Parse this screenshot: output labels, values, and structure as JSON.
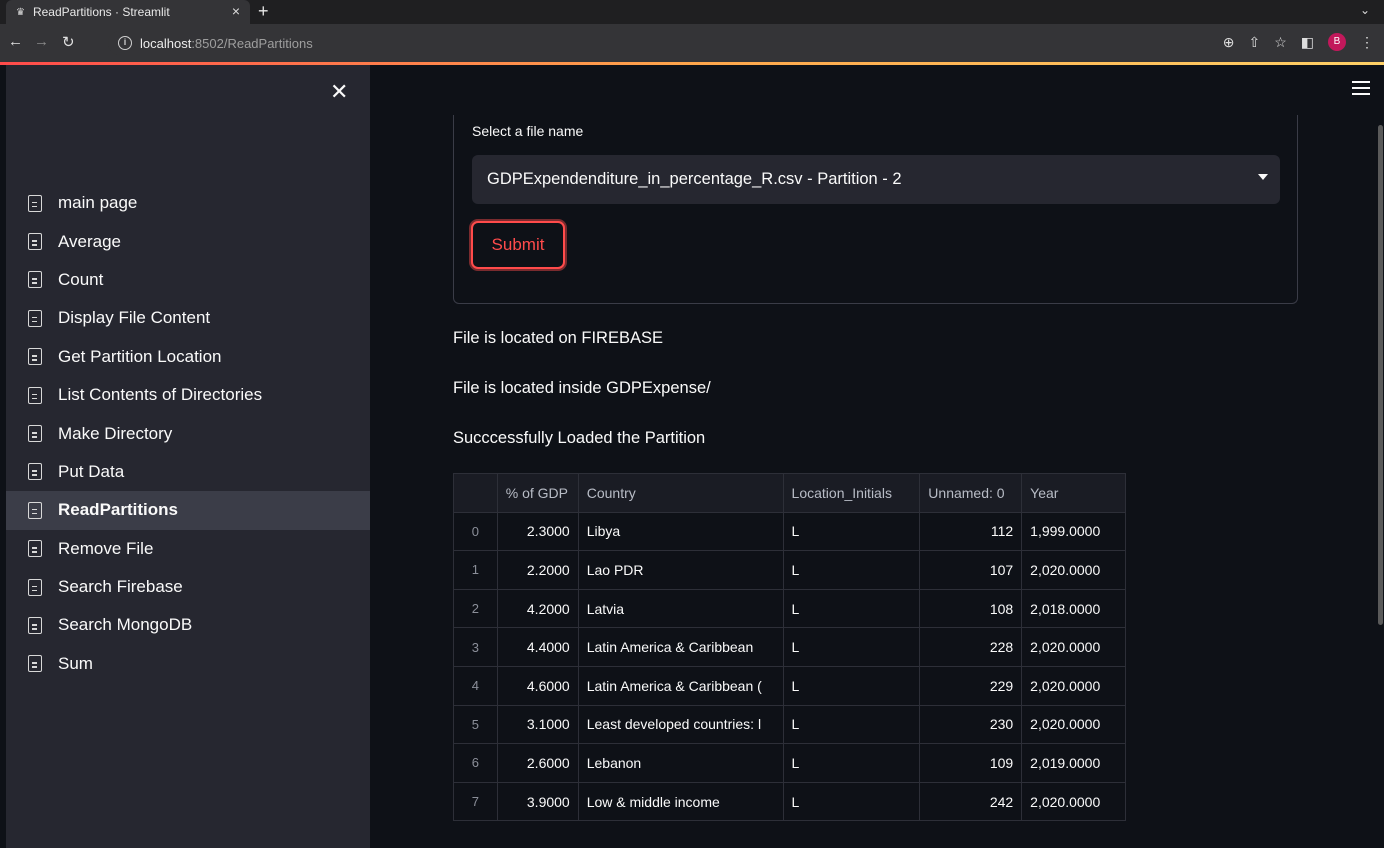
{
  "browser": {
    "tab_title": "ReadPartitions · Streamlit",
    "url_host": "localhost",
    "url_path": ":8502/ReadPartitions",
    "profile_initial": "B"
  },
  "sidebar": {
    "items": [
      {
        "label": "main page"
      },
      {
        "label": "Average"
      },
      {
        "label": "Count"
      },
      {
        "label": "Display File Content"
      },
      {
        "label": "Get Partition Location"
      },
      {
        "label": "List Contents of Directories"
      },
      {
        "label": "Make Directory"
      },
      {
        "label": "Put Data"
      },
      {
        "label": "ReadPartitions",
        "active": true
      },
      {
        "label": "Remove File"
      },
      {
        "label": "Search Firebase"
      },
      {
        "label": "Search MongoDB"
      },
      {
        "label": "Sum"
      }
    ]
  },
  "form": {
    "select_label": "Select a file name",
    "select_value": "GDPExpendenditure_in_percentage_R.csv - Partition - 2",
    "submit_label": "Submit"
  },
  "messages": {
    "location": "File is located on FIREBASE",
    "directory": "File is located inside GDPExpense/",
    "status": "Succcessfully Loaded the Partition"
  },
  "table": {
    "columns": [
      "% of GDP",
      "Country",
      "Location_Initials",
      "Unnamed: 0",
      "Year"
    ],
    "rows": [
      [
        "0",
        "2.3000",
        "Libya",
        "L",
        "112",
        "1,999.0000"
      ],
      [
        "1",
        "2.2000",
        "Lao PDR",
        "L",
        "107",
        "2,020.0000"
      ],
      [
        "2",
        "4.2000",
        "Latvia",
        "L",
        "108",
        "2,018.0000"
      ],
      [
        "3",
        "4.4000",
        "Latin America & Caribbean",
        "L",
        "228",
        "2,020.0000"
      ],
      [
        "4",
        "4.6000",
        "Latin America & Caribbean (",
        "L",
        "229",
        "2,020.0000"
      ],
      [
        "5",
        "3.1000",
        "Least developed countries: l",
        "L",
        "230",
        "2,020.0000"
      ],
      [
        "6",
        "2.6000",
        "Lebanon",
        "L",
        "109",
        "2,019.0000"
      ],
      [
        "7",
        "3.9000",
        "Low & middle income",
        "L",
        "242",
        "2,020.0000"
      ]
    ]
  }
}
